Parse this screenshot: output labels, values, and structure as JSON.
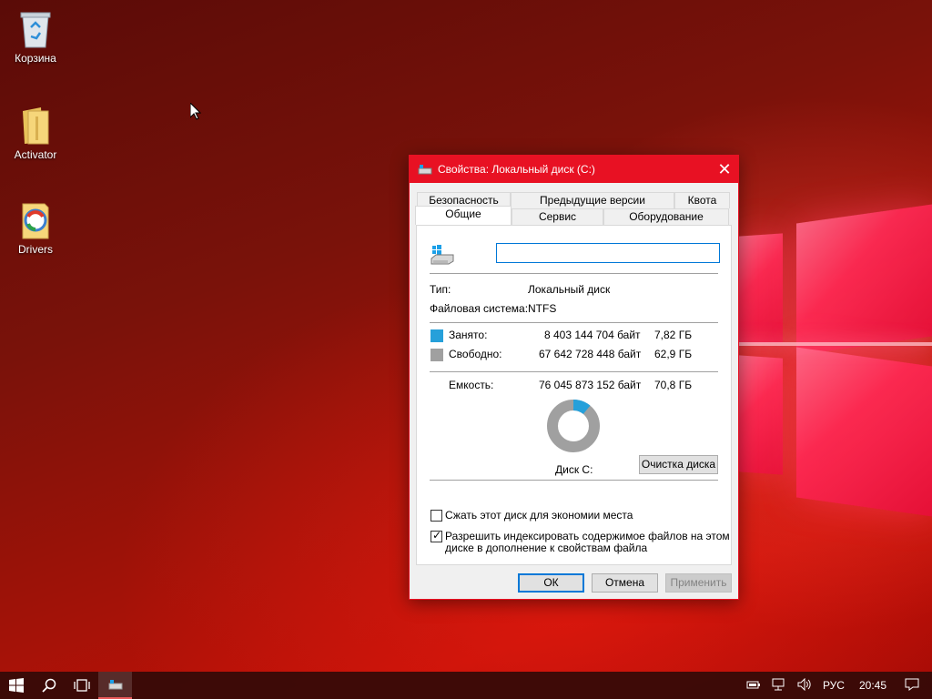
{
  "desktop": {
    "icons": [
      {
        "label": "Корзина",
        "icon": "recycle-bin-icon"
      },
      {
        "label": "Activator",
        "icon": "folder-icon"
      },
      {
        "label": "Drivers",
        "icon": "drivers-icon"
      }
    ]
  },
  "dialog": {
    "title": "Свойства: Локальный диск (C:)",
    "close_glyph": "✕",
    "tabs_back": [
      "Безопасность",
      "Предыдущие версии",
      "Квота"
    ],
    "tabs_front": [
      "Общие",
      "Сервис",
      "Оборудование"
    ],
    "active_tab": "Общие",
    "name_value": "",
    "type_label": "Тип:",
    "type_value": "Локальный диск",
    "fs_label": "Файловая система:",
    "fs_value": "NTFS",
    "used": {
      "label": "Занято:",
      "bytes": "8 403 144 704 байт",
      "size": "7,82 ГБ",
      "color": "#26a0da"
    },
    "free": {
      "label": "Свободно:",
      "bytes": "67 642 728 448 байт",
      "size": "62,9 ГБ",
      "color": "#a0a0a0"
    },
    "capacity": {
      "label": "Емкость:",
      "bytes": "76 045 873 152 байт",
      "size": "70,8 ГБ"
    },
    "used_fraction": 0.11,
    "disk_label": "Диск C:",
    "cleanup_button": "Очистка диска",
    "compress_label": "Сжать этот диск для экономии места",
    "compress_checked": false,
    "index_label_line1": "Разрешить индексировать содержимое файлов на этом",
    "index_label_line2": "диске в дополнение к свойствам файла",
    "index_checked": true,
    "ok_button": "ОК",
    "cancel_button": "Отмена",
    "apply_button": "Применить"
  },
  "taskbar": {
    "language": "РУС",
    "time": "20:45"
  }
}
